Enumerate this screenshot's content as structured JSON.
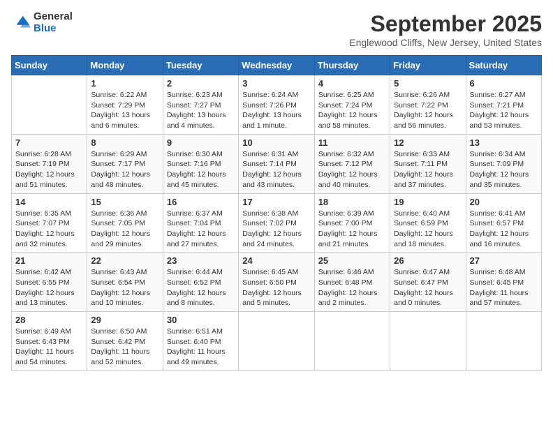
{
  "header": {
    "logo": {
      "general": "General",
      "blue": "Blue"
    },
    "title": "September 2025",
    "location": "Englewood Cliffs, New Jersey, United States"
  },
  "weekdays": [
    "Sunday",
    "Monday",
    "Tuesday",
    "Wednesday",
    "Thursday",
    "Friday",
    "Saturday"
  ],
  "weeks": [
    [
      {
        "day": null
      },
      {
        "day": 1,
        "sunrise": "6:22 AM",
        "sunset": "7:29 PM",
        "daylight": "13 hours and 6 minutes."
      },
      {
        "day": 2,
        "sunrise": "6:23 AM",
        "sunset": "7:27 PM",
        "daylight": "13 hours and 4 minutes."
      },
      {
        "day": 3,
        "sunrise": "6:24 AM",
        "sunset": "7:26 PM",
        "daylight": "13 hours and 1 minute."
      },
      {
        "day": 4,
        "sunrise": "6:25 AM",
        "sunset": "7:24 PM",
        "daylight": "12 hours and 58 minutes."
      },
      {
        "day": 5,
        "sunrise": "6:26 AM",
        "sunset": "7:22 PM",
        "daylight": "12 hours and 56 minutes."
      },
      {
        "day": 6,
        "sunrise": "6:27 AM",
        "sunset": "7:21 PM",
        "daylight": "12 hours and 53 minutes."
      }
    ],
    [
      {
        "day": 7,
        "sunrise": "6:28 AM",
        "sunset": "7:19 PM",
        "daylight": "12 hours and 51 minutes."
      },
      {
        "day": 8,
        "sunrise": "6:29 AM",
        "sunset": "7:17 PM",
        "daylight": "12 hours and 48 minutes."
      },
      {
        "day": 9,
        "sunrise": "6:30 AM",
        "sunset": "7:16 PM",
        "daylight": "12 hours and 45 minutes."
      },
      {
        "day": 10,
        "sunrise": "6:31 AM",
        "sunset": "7:14 PM",
        "daylight": "12 hours and 43 minutes."
      },
      {
        "day": 11,
        "sunrise": "6:32 AM",
        "sunset": "7:12 PM",
        "daylight": "12 hours and 40 minutes."
      },
      {
        "day": 12,
        "sunrise": "6:33 AM",
        "sunset": "7:11 PM",
        "daylight": "12 hours and 37 minutes."
      },
      {
        "day": 13,
        "sunrise": "6:34 AM",
        "sunset": "7:09 PM",
        "daylight": "12 hours and 35 minutes."
      }
    ],
    [
      {
        "day": 14,
        "sunrise": "6:35 AM",
        "sunset": "7:07 PM",
        "daylight": "12 hours and 32 minutes."
      },
      {
        "day": 15,
        "sunrise": "6:36 AM",
        "sunset": "7:05 PM",
        "daylight": "12 hours and 29 minutes."
      },
      {
        "day": 16,
        "sunrise": "6:37 AM",
        "sunset": "7:04 PM",
        "daylight": "12 hours and 27 minutes."
      },
      {
        "day": 17,
        "sunrise": "6:38 AM",
        "sunset": "7:02 PM",
        "daylight": "12 hours and 24 minutes."
      },
      {
        "day": 18,
        "sunrise": "6:39 AM",
        "sunset": "7:00 PM",
        "daylight": "12 hours and 21 minutes."
      },
      {
        "day": 19,
        "sunrise": "6:40 AM",
        "sunset": "6:59 PM",
        "daylight": "12 hours and 18 minutes."
      },
      {
        "day": 20,
        "sunrise": "6:41 AM",
        "sunset": "6:57 PM",
        "daylight": "12 hours and 16 minutes."
      }
    ],
    [
      {
        "day": 21,
        "sunrise": "6:42 AM",
        "sunset": "6:55 PM",
        "daylight": "12 hours and 13 minutes."
      },
      {
        "day": 22,
        "sunrise": "6:43 AM",
        "sunset": "6:54 PM",
        "daylight": "12 hours and 10 minutes."
      },
      {
        "day": 23,
        "sunrise": "6:44 AM",
        "sunset": "6:52 PM",
        "daylight": "12 hours and 8 minutes."
      },
      {
        "day": 24,
        "sunrise": "6:45 AM",
        "sunset": "6:50 PM",
        "daylight": "12 hours and 5 minutes."
      },
      {
        "day": 25,
        "sunrise": "6:46 AM",
        "sunset": "6:48 PM",
        "daylight": "12 hours and 2 minutes."
      },
      {
        "day": 26,
        "sunrise": "6:47 AM",
        "sunset": "6:47 PM",
        "daylight": "12 hours and 0 minutes."
      },
      {
        "day": 27,
        "sunrise": "6:48 AM",
        "sunset": "6:45 PM",
        "daylight": "11 hours and 57 minutes."
      }
    ],
    [
      {
        "day": 28,
        "sunrise": "6:49 AM",
        "sunset": "6:43 PM",
        "daylight": "11 hours and 54 minutes."
      },
      {
        "day": 29,
        "sunrise": "6:50 AM",
        "sunset": "6:42 PM",
        "daylight": "11 hours and 52 minutes."
      },
      {
        "day": 30,
        "sunrise": "6:51 AM",
        "sunset": "6:40 PM",
        "daylight": "11 hours and 49 minutes."
      },
      {
        "day": null
      },
      {
        "day": null
      },
      {
        "day": null
      },
      {
        "day": null
      }
    ]
  ]
}
